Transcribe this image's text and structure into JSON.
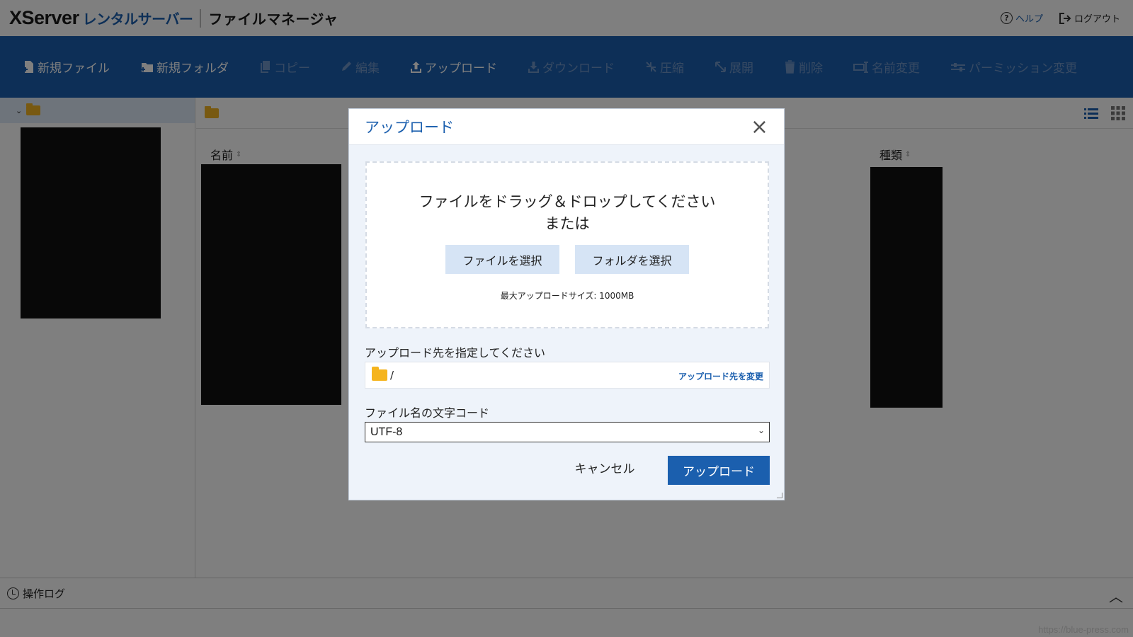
{
  "header": {
    "logo_main": "XServer",
    "logo_sub": "レンタルサーバー",
    "app_name": "ファイルマネージャ",
    "help_label": "ヘルプ",
    "logout_label": "ログアウト"
  },
  "toolbar": {
    "items": [
      {
        "label": "新規ファイル",
        "icon": "new-file-icon",
        "enabled": true
      },
      {
        "label": "新規フォルダ",
        "icon": "new-folder-icon",
        "enabled": true
      },
      {
        "label": "コピー",
        "icon": "copy-icon",
        "enabled": false
      },
      {
        "label": "編集",
        "icon": "edit-icon",
        "enabled": false
      },
      {
        "label": "アップロード",
        "icon": "upload-icon",
        "enabled": true
      },
      {
        "label": "ダウンロード",
        "icon": "download-icon",
        "enabled": false
      },
      {
        "label": "圧縮",
        "icon": "compress-icon",
        "enabled": false
      },
      {
        "label": "展開",
        "icon": "extract-icon",
        "enabled": false
      },
      {
        "label": "削除",
        "icon": "trash-icon",
        "enabled": false
      },
      {
        "label": "名前変更",
        "icon": "rename-icon",
        "enabled": false
      },
      {
        "label": "パーミッション変更",
        "icon": "permission-icon",
        "enabled": false
      }
    ]
  },
  "file_list": {
    "col_name": "名前",
    "col_type": "種類"
  },
  "bottom": {
    "log_label": "操作ログ"
  },
  "modal": {
    "title": "アップロード",
    "drop_text": "ファイルをドラッグ＆ドロップしてください",
    "or_text": "または",
    "select_file": "ファイルを選択",
    "select_folder": "フォルダを選択",
    "max_size": "最大アップロードサイズ: 1000MB",
    "dest_label": "アップロード先を指定してください",
    "dest_path": "/",
    "dest_change": "アップロード先を変更",
    "encoding_label": "ファイル名の文字コード",
    "encoding_value": "UTF-8",
    "cancel": "キャンセル",
    "upload": "アップロード"
  },
  "colors": {
    "brand": "#1b5fae",
    "folder": "#f5b41d"
  },
  "watermark": "https://blue-press.com"
}
